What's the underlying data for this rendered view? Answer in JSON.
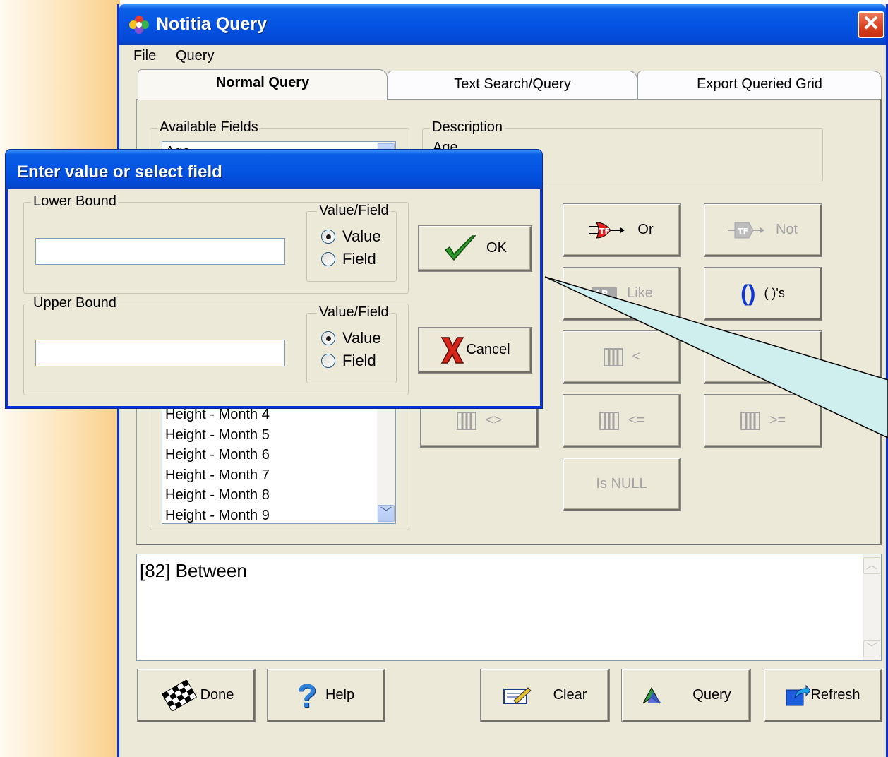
{
  "window": {
    "title": "Notitia Query",
    "close_label": "✕"
  },
  "menu": [
    "File",
    "Query"
  ],
  "tabs": [
    "Normal Query",
    "Text Search/Query",
    "Export Queried Grid"
  ],
  "available_fields": {
    "label": "Available Fields",
    "top_item": "Age",
    "items": [
      "Height - Month 4",
      "Height - Month 5",
      "Height - Month 6",
      "Height - Month 7",
      "Height - Month 8",
      "Height - Month 9"
    ]
  },
  "description": {
    "label": "Description",
    "value": "Age"
  },
  "operators": {
    "or": "Or",
    "not": "Not",
    "like": "Like",
    "parens": "( )'s",
    "lt": "<",
    "ne": "<>",
    "le": "<=",
    "ge": ">=",
    "is_null": "Is NULL"
  },
  "query_text": "[82] Between",
  "bottom_buttons": {
    "done": "Done",
    "help": "Help",
    "clear": "Clear",
    "query": "Query",
    "refresh": "Refresh"
  },
  "dialog": {
    "title": "Enter value or select field",
    "lower": {
      "label": "Lower Bound",
      "vf_label": "Value/Field",
      "value_label": "Value",
      "field_label": "Field",
      "value": ""
    },
    "upper": {
      "label": "Upper Bound",
      "vf_label": "Value/Field",
      "value_label": "Value",
      "field_label": "Field",
      "value": ""
    },
    "ok": "OK",
    "cancel": "Cancel"
  }
}
